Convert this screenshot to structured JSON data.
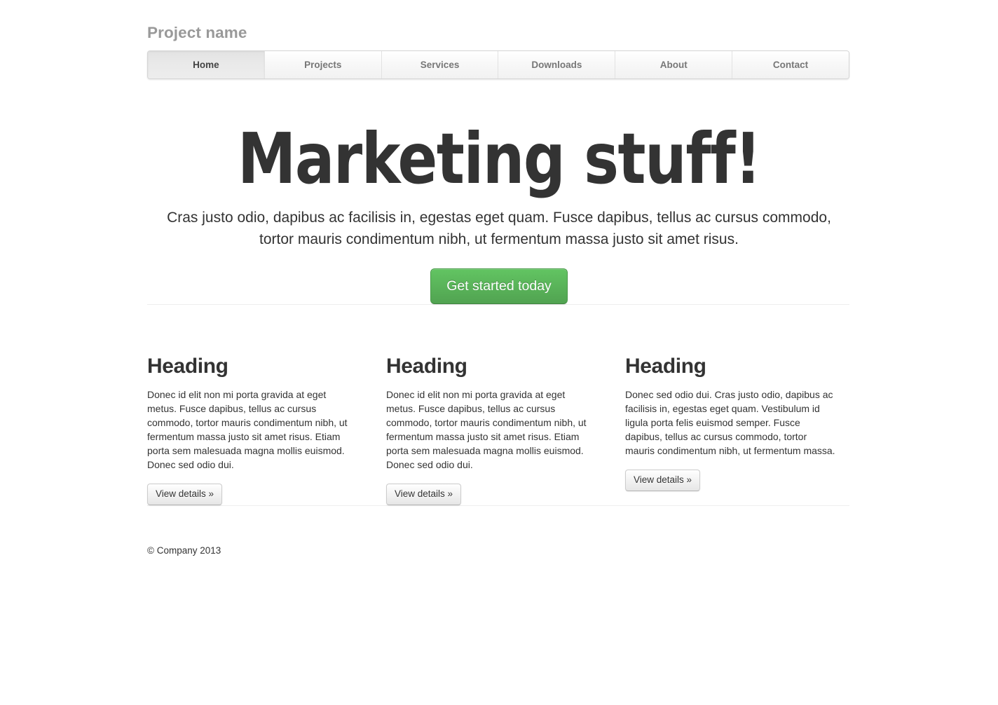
{
  "masthead": {
    "brand": "Project name"
  },
  "nav": {
    "items": [
      {
        "label": "Home",
        "active": true
      },
      {
        "label": "Projects",
        "active": false
      },
      {
        "label": "Services",
        "active": false
      },
      {
        "label": "Downloads",
        "active": false
      },
      {
        "label": "About",
        "active": false
      },
      {
        "label": "Contact",
        "active": false
      }
    ]
  },
  "hero": {
    "title": "Marketing stuff!",
    "lead": "Cras justo odio, dapibus ac facilisis in, egestas eget quam. Fusce dapibus, tellus ac cursus commodo, tortor mauris condimentum nibh, ut fermentum massa justo sit amet risus.",
    "cta_label": "Get started today"
  },
  "columns": [
    {
      "heading": "Heading",
      "body": "Donec id elit non mi porta gravida at eget metus. Fusce dapibus, tellus ac cursus commodo, tortor mauris condimentum nibh, ut fermentum massa justo sit amet risus. Etiam porta sem malesuada magna mollis euismod. Donec sed odio dui.",
      "button_label": "View details »"
    },
    {
      "heading": "Heading",
      "body": "Donec id elit non mi porta gravida at eget metus. Fusce dapibus, tellus ac cursus commodo, tortor mauris condimentum nibh, ut fermentum massa justo sit amet risus. Etiam porta sem malesuada magna mollis euismod. Donec sed odio dui.",
      "button_label": "View details »"
    },
    {
      "heading": "Heading",
      "body": "Donec sed odio dui. Cras justo odio, dapibus ac facilisis in, egestas eget quam. Vestibulum id ligula porta felis euismod semper. Fusce dapibus, tellus ac cursus commodo, tortor mauris condimentum nibh, ut fermentum massa.",
      "button_label": "View details »"
    }
  ],
  "footer": {
    "copyright": "© Company 2013"
  },
  "colors": {
    "brand_text": "#999999",
    "heading_text": "#333333",
    "nav_active_text": "#444444",
    "nav_inactive_text": "#777777",
    "cta_green_top": "#62c462",
    "cta_green_bottom": "#51a351",
    "divider": "#eeeeee"
  }
}
